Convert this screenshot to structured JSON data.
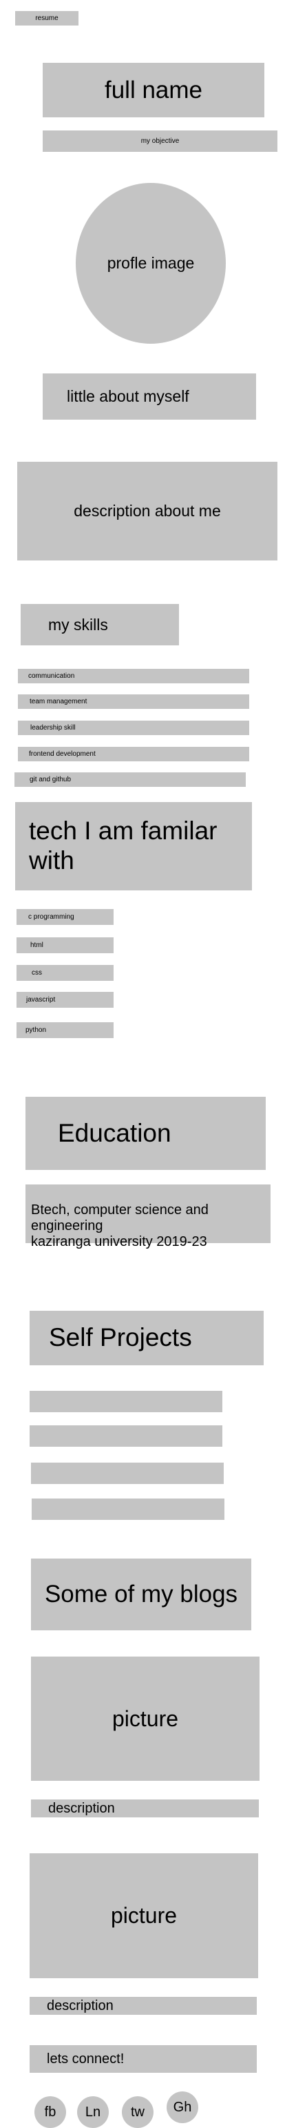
{
  "header": {
    "resume_label": "resume"
  },
  "profile": {
    "full_name": "full name",
    "objective": "my objective",
    "image_label": "profle image",
    "about_heading": "little about myself",
    "description": "description about me"
  },
  "skills": {
    "heading": "my skills",
    "items": [
      "communication",
      "team management",
      "leadership skill",
      "frontend development",
      "git and github"
    ]
  },
  "tech": {
    "heading": "tech I am familar with",
    "items": [
      "c programming",
      "html",
      "css",
      "javascript",
      "python"
    ]
  },
  "education": {
    "heading": "Education",
    "entry_line1": "Btech, computer science and engineering",
    "entry_line2": "kaziranga university 2019-23"
  },
  "projects": {
    "heading": "Self Projects"
  },
  "blogs": {
    "heading": "Some of my blogs",
    "posts": [
      {
        "picture_label": "picture",
        "description": "description"
      },
      {
        "picture_label": "picture",
        "description": "description"
      }
    ]
  },
  "connect": {
    "label": "lets connect!",
    "social": [
      "fb",
      "Ln",
      "tw",
      "Gh"
    ]
  }
}
